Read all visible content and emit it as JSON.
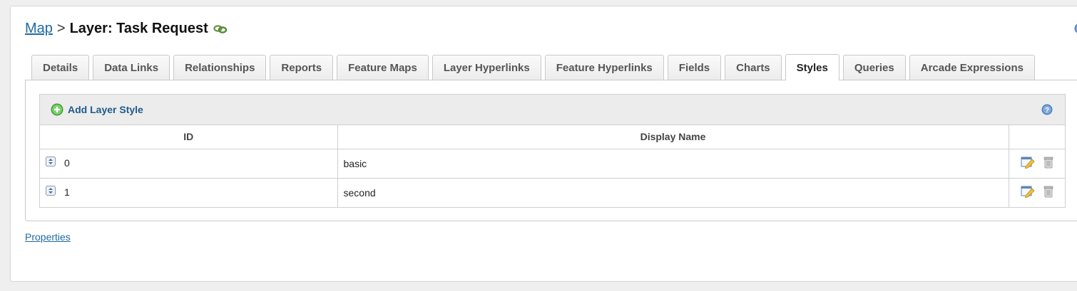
{
  "breadcrumb": {
    "root_label": "Map",
    "separator": ">",
    "current_label": "Layer: Task Request"
  },
  "tabs": [
    {
      "label": "Details",
      "active": false
    },
    {
      "label": "Data Links",
      "active": false
    },
    {
      "label": "Relationships",
      "active": false
    },
    {
      "label": "Reports",
      "active": false
    },
    {
      "label": "Feature Maps",
      "active": false
    },
    {
      "label": "Layer Hyperlinks",
      "active": false
    },
    {
      "label": "Feature Hyperlinks",
      "active": false
    },
    {
      "label": "Fields",
      "active": false
    },
    {
      "label": "Charts",
      "active": false
    },
    {
      "label": "Styles",
      "active": true
    },
    {
      "label": "Queries",
      "active": false
    },
    {
      "label": "Arcade Expressions",
      "active": false
    }
  ],
  "styles_grid": {
    "add_label": "Add Layer Style",
    "columns": {
      "id": "ID",
      "display_name": "Display Name",
      "actions": ""
    },
    "rows": [
      {
        "id": "0",
        "display_name": "basic"
      },
      {
        "id": "1",
        "display_name": "second"
      }
    ]
  },
  "footer": {
    "properties_label": "Properties"
  },
  "icons": {
    "layer_link": "chain-link-icon",
    "help": "help-icon",
    "add": "add-circle-icon",
    "sort": "sort-handle-icon",
    "edit": "edit-icon",
    "delete": "trash-icon"
  },
  "colors": {
    "link": "#1f6aa3",
    "accent_green": "#4caf50",
    "help_blue": "#4a7fc1"
  }
}
